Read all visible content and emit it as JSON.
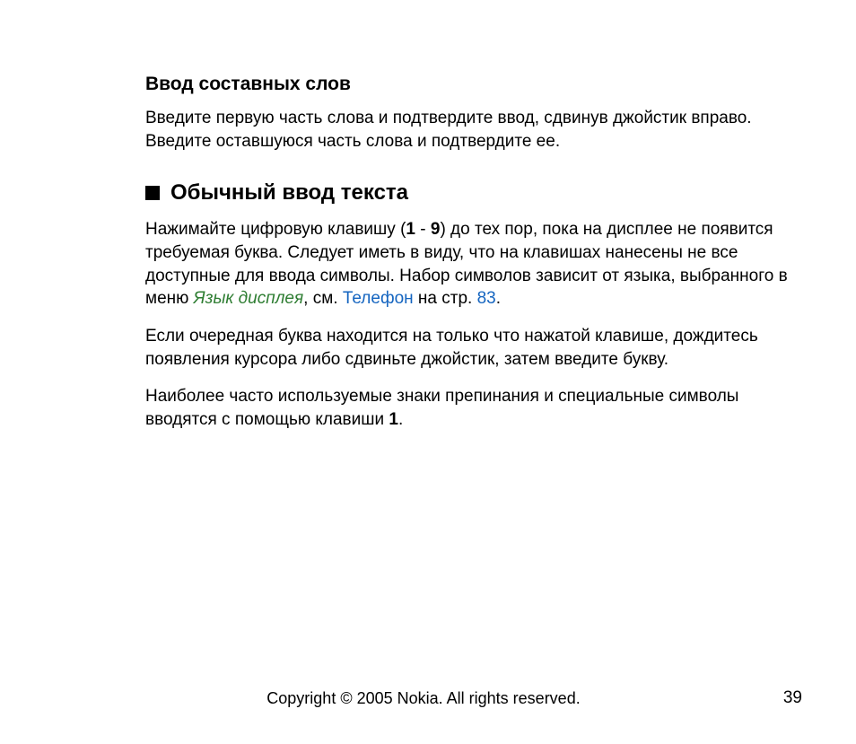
{
  "section1": {
    "heading": "Ввод составных слов",
    "para": "Введите первую часть слова и подтвердите ввод, сдвинув джойстик вправо. Введите оставшуюся часть слова и подтвердите ее."
  },
  "section2": {
    "heading": "Обычный ввод текста",
    "p1_a": "Нажимайте цифровую клавишу (",
    "p1_b": "1",
    "p1_c": " - ",
    "p1_d": "9",
    "p1_e": ") до тех пор, пока на дисплее не появится требуемая буква. Следует иметь в виду, что на клавишах нанесены не все доступные для ввода символы. Набор символов зависит от языка, выбранного в меню ",
    "p1_menu": "Язык дисплея",
    "p1_f": ", см. ",
    "p1_link": "Телефон",
    "p1_g": " на стр. ",
    "p1_page": "83",
    "p1_h": ".",
    "p2": "Если очередная буква находится на только что нажатой клавише, дождитесь появления курсора либо сдвиньте джойстик, затем введите букву.",
    "p3_a": "Наиболее часто используемые знаки препинания и специальные символы вводятся с помощью клавиши ",
    "p3_b": "1",
    "p3_c": "."
  },
  "footer": {
    "copyright": "Copyright © 2005 Nokia. All rights reserved.",
    "page": "39"
  }
}
